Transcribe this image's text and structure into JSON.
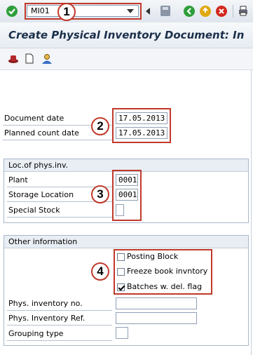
{
  "command_field": {
    "value": "MI01"
  },
  "title": "Create Physical Inventory Document: In",
  "header_fields": {
    "document_date": {
      "label": "Document date",
      "value": "17.05.2013"
    },
    "planned_count_date": {
      "label": "Planned count date",
      "value": "17.05.2013"
    }
  },
  "loc_group": {
    "title": "Loc.of phys.inv.",
    "plant": {
      "label": "Plant",
      "value": "0001"
    },
    "storage_location": {
      "label": "Storage Location",
      "value": "0001"
    },
    "special_stock": {
      "label": "Special Stock",
      "value": ""
    }
  },
  "other_group": {
    "title": "Other information",
    "checkboxes": [
      {
        "label": "Posting Block",
        "checked": false
      },
      {
        "label": "Freeze book invntory",
        "checked": false
      },
      {
        "label": "Batches w. del. flag",
        "checked": true
      }
    ],
    "phys_inventory_no": {
      "label": "Phys. inventory no.",
      "value": ""
    },
    "phys_inventory_ref": {
      "label": "Phys. Inventory Ref.",
      "value": ""
    },
    "grouping_type": {
      "label": "Grouping type",
      "value": ""
    }
  },
  "callouts": [
    "1",
    "2",
    "3",
    "4"
  ],
  "colors": {
    "callout_red": "#c0392b",
    "title_text": "#1b2f4a"
  }
}
